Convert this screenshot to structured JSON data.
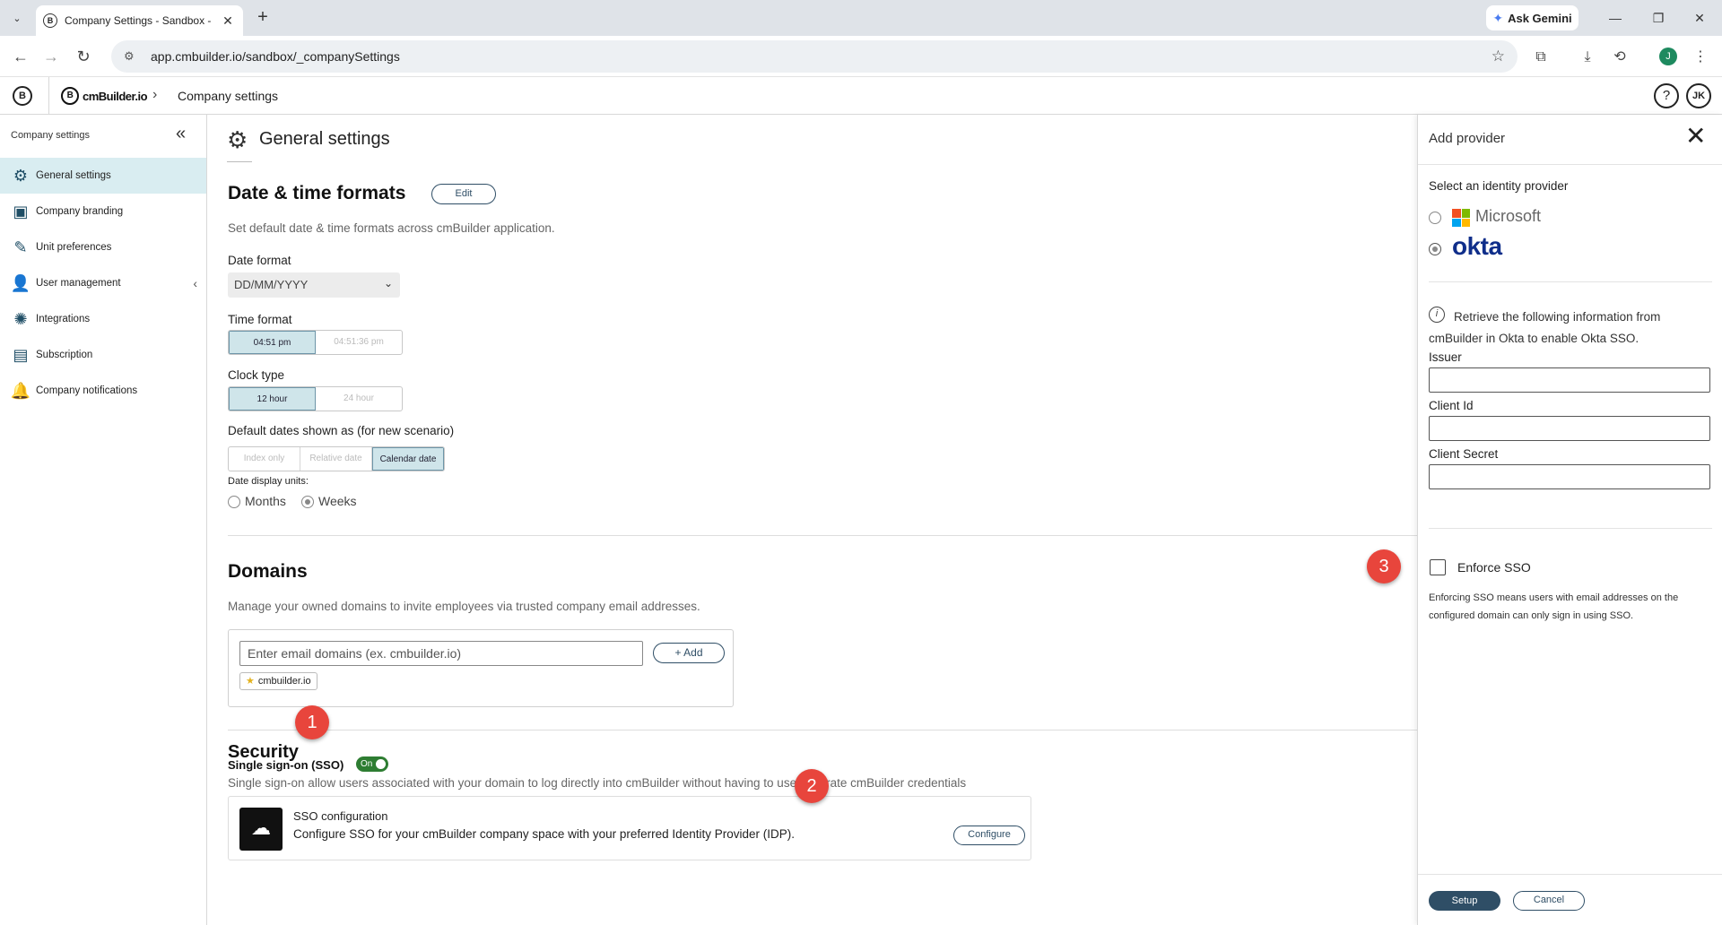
{
  "browser": {
    "tab_title": "Company Settings - Sandbox -",
    "tab_favicon": "B",
    "new_tab": "+",
    "tab_search": "⌄",
    "gemini_label": "Ask Gemini",
    "url": "app.cmbuilder.io/sandbox/_companySettings",
    "profile_initial": "J",
    "win_min": "—",
    "win_restore": "❐",
    "win_close": "✕"
  },
  "app": {
    "logo": "B",
    "brand": "cmBuilder.io",
    "breadcrumb": "Company settings",
    "help": "?",
    "user_initials": "JK"
  },
  "sidebar": {
    "title": "Company settings",
    "items": [
      {
        "label": "General settings",
        "icon": "gear-icon"
      },
      {
        "label": "Company branding",
        "icon": "branding-icon"
      },
      {
        "label": "Unit preferences",
        "icon": "ruler-icon"
      },
      {
        "label": "User management",
        "icon": "users-icon"
      },
      {
        "label": "Integrations",
        "icon": "integrations-icon"
      },
      {
        "label": "Subscription",
        "icon": "subscription-icon"
      },
      {
        "label": "Company notifications",
        "icon": "bell-icon"
      }
    ]
  },
  "main": {
    "title": "General settings",
    "datetime": {
      "heading": "Date & time formats",
      "edit": "Edit",
      "description": "Set default date & time formats across cmBuilder application.",
      "date_format_label": "Date format",
      "date_format_value": "DD/MM/YYYY",
      "time_format_label": "Time format",
      "time_options": [
        "04:51 pm",
        "04:51:36 pm"
      ],
      "clock_label": "Clock type",
      "clock_options": [
        "12 hour",
        "24 hour"
      ],
      "default_dates_label": "Default dates shown as (for new scenario)",
      "default_dates_options": [
        "Index only",
        "Relative date",
        "Calendar date"
      ],
      "display_units_label": "Date display units:",
      "units": [
        "Months",
        "Weeks"
      ]
    },
    "domains": {
      "heading": "Domains",
      "description": "Manage your owned domains to invite employees via trusted company email addresses.",
      "input_placeholder": "Enter email domains (ex. cmbuilder.io)",
      "add": "Add",
      "chip": "cmbuilder.io"
    },
    "security": {
      "heading": "Security",
      "sso_label": "Single sign-on (SSO)",
      "toggle": "On",
      "sso_description": "Single sign-on allow users associated with your domain to log directly into cmBuilder without having to use separate cmBuilder credentials",
      "card_title": "SSO configuration",
      "card_description": "Configure SSO for your cmBuilder company space with your preferred Identity Provider (IDP).",
      "configure": "Configure"
    }
  },
  "panel": {
    "title": "Add provider",
    "select_label": "Select an identity provider",
    "providers": [
      "Microsoft",
      "okta"
    ],
    "info": "Retrieve the following information from cmBuilder in Okta to enable Okta SSO.",
    "issuer": "Issuer",
    "client_id": "Client Id",
    "client_secret": "Client Secret",
    "enforce": "Enforce SSO",
    "enforce_note": "Enforcing SSO means users with email addresses on the configured domain can only sign in using SSO.",
    "setup": "Setup",
    "cancel": "Cancel"
  },
  "callouts": [
    "1",
    "2",
    "3"
  ],
  "colors": {
    "accent": "#2f4e66",
    "active_bg": "#d9edf1",
    "toggle_on": "#2e7d32",
    "callout": "#e8453c"
  }
}
